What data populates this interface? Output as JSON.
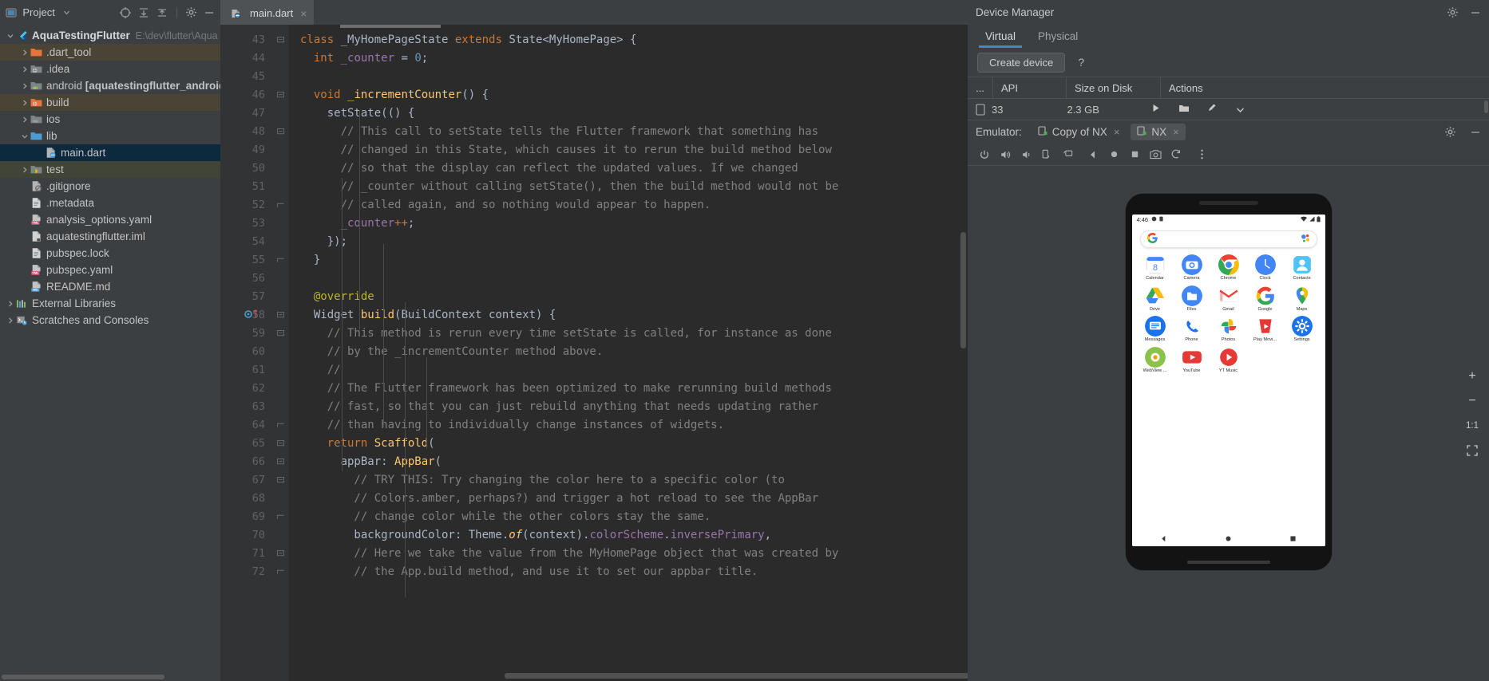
{
  "project_panel": {
    "title": "Project",
    "toolbar_icons": [
      "project-view-icon",
      "dropdown-icon",
      "locate-icon",
      "expand-all-icon",
      "collapse-all-icon",
      "settings-icon",
      "hide-icon"
    ],
    "root": {
      "name": "AquaTestingFlutter",
      "path": "E:\\dev\\flutter\\Aqua"
    },
    "items": [
      {
        "label": ".dart_tool",
        "icon": "folder-orange-icon",
        "indent": 1,
        "arrow": "right",
        "state": "highlight-1"
      },
      {
        "label": ".idea",
        "icon": "folder-idea-icon",
        "indent": 1,
        "arrow": "right",
        "state": "none"
      },
      {
        "label": "android ",
        "bold_suffix": "[aquatestingflutter_android]",
        "icon": "folder-android-icon",
        "indent": 1,
        "arrow": "right",
        "state": "none"
      },
      {
        "label": "build",
        "icon": "folder-build-icon",
        "indent": 1,
        "arrow": "right",
        "state": "highlight-1"
      },
      {
        "label": "ios",
        "icon": "folder-ios-icon",
        "indent": 1,
        "arrow": "right",
        "state": "none"
      },
      {
        "label": "lib",
        "icon": "folder-blue-icon",
        "indent": 1,
        "arrow": "down",
        "state": "none"
      },
      {
        "label": "main.dart",
        "icon": "dart-file-icon",
        "indent": 2,
        "arrow": "none",
        "state": "selected"
      },
      {
        "label": "test",
        "icon": "folder-test-icon",
        "indent": 1,
        "arrow": "right",
        "state": "highlight-2"
      },
      {
        "label": ".gitignore",
        "icon": "gitignore-file-icon",
        "indent": 1,
        "arrow": "none",
        "state": "none"
      },
      {
        "label": ".metadata",
        "icon": "text-file-icon",
        "indent": 1,
        "arrow": "none",
        "state": "none"
      },
      {
        "label": "analysis_options.yaml",
        "icon": "yaml-file-icon",
        "indent": 1,
        "arrow": "none",
        "state": "none"
      },
      {
        "label": "aquatestingflutter.iml",
        "icon": "iml-file-icon",
        "indent": 1,
        "arrow": "none",
        "state": "none"
      },
      {
        "label": "pubspec.lock",
        "icon": "text-file-icon",
        "indent": 1,
        "arrow": "none",
        "state": "none"
      },
      {
        "label": "pubspec.yaml",
        "icon": "yaml-file-icon",
        "indent": 1,
        "arrow": "none",
        "state": "none"
      },
      {
        "label": "README.md",
        "icon": "markdown-file-icon",
        "indent": 1,
        "arrow": "none",
        "state": "none"
      },
      {
        "label": "External Libraries",
        "icon": "libraries-icon",
        "indent": 0,
        "arrow": "right",
        "state": "none"
      },
      {
        "label": "Scratches and Consoles",
        "icon": "scratches-icon",
        "indent": 0,
        "arrow": "right",
        "state": "none"
      }
    ]
  },
  "editor": {
    "tab": {
      "label": "main.dart",
      "icon": "dart-file-icon",
      "close": "×"
    },
    "inspection_status": "✓",
    "first_line": 43,
    "lines": [
      {
        "n": 43,
        "fold": "start",
        "tokens": [
          {
            "t": "class ",
            "c": "kw"
          },
          {
            "t": "_MyHomePageState ",
            "c": "cls"
          },
          {
            "t": "extends ",
            "c": "kw"
          },
          {
            "t": "State<MyHomePage> {",
            "c": "cls"
          }
        ]
      },
      {
        "n": 44,
        "fold": "",
        "indent": 1,
        "tokens": [
          {
            "t": "  int",
            "c": "kw"
          },
          {
            "t": " _counter ",
            "c": "fld"
          },
          {
            "t": "= ",
            "c": "cls"
          },
          {
            "t": "0",
            "c": "num"
          },
          {
            "t": ";",
            "c": "cls"
          }
        ]
      },
      {
        "n": 45,
        "fold": "",
        "tokens": []
      },
      {
        "n": 46,
        "fold": "start",
        "tokens": [
          {
            "t": "  void ",
            "c": "kw"
          },
          {
            "t": "_incrementCounter",
            "c": "fn"
          },
          {
            "t": "() {",
            "c": "cls"
          }
        ]
      },
      {
        "n": 47,
        "fold": "",
        "tokens": [
          {
            "t": "    setState(() {",
            "c": "cls"
          }
        ]
      },
      {
        "n": 48,
        "fold": "start",
        "tokens": [
          {
            "t": "      // This call to setState tells the Flutter framework that something has",
            "c": "cm"
          }
        ]
      },
      {
        "n": 49,
        "fold": "",
        "tokens": [
          {
            "t": "      // changed in this State, which causes it to rerun the build method below",
            "c": "cm"
          }
        ]
      },
      {
        "n": 50,
        "fold": "",
        "tokens": [
          {
            "t": "      // so that the display can reflect the updated values. If we changed",
            "c": "cm"
          }
        ]
      },
      {
        "n": 51,
        "fold": "",
        "tokens": [
          {
            "t": "      // _counter without calling setState(), then the build method would not be",
            "c": "cm"
          }
        ]
      },
      {
        "n": 52,
        "fold": "end",
        "tokens": [
          {
            "t": "      // called again, and so nothing would appear to happen.",
            "c": "cm"
          }
        ]
      },
      {
        "n": 53,
        "fold": "",
        "tokens": [
          {
            "t": "      _counter",
            "c": "fld"
          },
          {
            "t": "++",
            "c": "kw"
          },
          {
            "t": ";",
            "c": "cls"
          }
        ]
      },
      {
        "n": 54,
        "fold": "",
        "tokens": [
          {
            "t": "    });",
            "c": "cls"
          }
        ]
      },
      {
        "n": 55,
        "fold": "end",
        "tokens": [
          {
            "t": "  }",
            "c": "cls"
          }
        ]
      },
      {
        "n": 56,
        "fold": "",
        "tokens": []
      },
      {
        "n": 57,
        "fold": "",
        "tokens": [
          {
            "t": "  @override",
            "c": "ann"
          }
        ]
      },
      {
        "n": 58,
        "fold": "start",
        "gutter_mark": "run-override-marker",
        "tokens": [
          {
            "t": "  Widget ",
            "c": "cls"
          },
          {
            "t": "build",
            "c": "fn"
          },
          {
            "t": "(BuildContext context) {",
            "c": "cls"
          }
        ]
      },
      {
        "n": 59,
        "fold": "start",
        "tokens": [
          {
            "t": "    // This method is rerun every time setState is called, for instance as done",
            "c": "cm"
          }
        ]
      },
      {
        "n": 60,
        "fold": "",
        "tokens": [
          {
            "t": "    // by the _incrementCounter method above.",
            "c": "cm"
          }
        ]
      },
      {
        "n": 61,
        "fold": "",
        "tokens": [
          {
            "t": "    //",
            "c": "cm"
          }
        ]
      },
      {
        "n": 62,
        "fold": "",
        "tokens": [
          {
            "t": "    // The Flutter framework has been optimized to make rerunning build methods",
            "c": "cm"
          }
        ]
      },
      {
        "n": 63,
        "fold": "",
        "tokens": [
          {
            "t": "    // fast, so that you can just rebuild anything that needs updating rather",
            "c": "cm"
          }
        ]
      },
      {
        "n": 64,
        "fold": "end",
        "tokens": [
          {
            "t": "    // than having to individually change instances of widgets.",
            "c": "cm"
          }
        ]
      },
      {
        "n": 65,
        "fold": "start",
        "tokens": [
          {
            "t": "    return ",
            "c": "kw"
          },
          {
            "t": "Scaffold",
            "c": "fn"
          },
          {
            "t": "(",
            "c": "cls"
          }
        ]
      },
      {
        "n": 66,
        "fold": "start",
        "tokens": [
          {
            "t": "      appBar: ",
            "c": "cls"
          },
          {
            "t": "AppBar",
            "c": "fn"
          },
          {
            "t": "(",
            "c": "cls"
          }
        ]
      },
      {
        "n": 67,
        "fold": "start",
        "tokens": [
          {
            "t": "        // TRY THIS: Try changing the color here to a specific color (to",
            "c": "cm"
          }
        ]
      },
      {
        "n": 68,
        "fold": "",
        "tokens": [
          {
            "t": "        // Colors.amber, perhaps?) and trigger a hot reload to see the AppBar",
            "c": "cm"
          }
        ]
      },
      {
        "n": 69,
        "fold": "end",
        "tokens": [
          {
            "t": "        // change color while the other colors stay the same.",
            "c": "cm"
          }
        ]
      },
      {
        "n": 70,
        "fold": "",
        "tokens": [
          {
            "t": "        backgroundColor: Theme.",
            "c": "cls"
          },
          {
            "t": "of",
            "c": "fn ital"
          },
          {
            "t": "(context).",
            "c": "cls"
          },
          {
            "t": "colorScheme",
            "c": "fld"
          },
          {
            "t": ".",
            "c": "cls"
          },
          {
            "t": "inversePrimary",
            "c": "fld"
          },
          {
            "t": ",",
            "c": "cls"
          }
        ]
      },
      {
        "n": 71,
        "fold": "start",
        "tokens": [
          {
            "t": "        // Here we take the value from the MyHomePage object that was created by",
            "c": "cm"
          }
        ]
      },
      {
        "n": 72,
        "fold": "end",
        "tokens": [
          {
            "t": "        // the App.build method, and use it to set our appbar title.",
            "c": "cm"
          }
        ]
      }
    ]
  },
  "device_manager": {
    "title": "Device Manager",
    "header_icons": [
      "gear-icon",
      "hide-icon"
    ],
    "tabs": [
      {
        "label": "Virtual",
        "active": true
      },
      {
        "label": "Physical",
        "active": false
      }
    ],
    "create_device_label": "Create device",
    "help_label": "?",
    "columns": [
      "...",
      "API",
      "Size on Disk",
      "Actions"
    ],
    "row_actions": [
      "play-icon",
      "folder-icon",
      "edit-icon",
      "chevron-down-icon"
    ],
    "emulator_bar": {
      "label": "Emulator:",
      "tabs": [
        {
          "label": "Copy of NX",
          "active": false,
          "close": "×",
          "icon": "device-icon"
        },
        {
          "label": "NX",
          "active": true,
          "close": "×",
          "icon": "device-icon"
        }
      ],
      "right_icons": [
        "gear-icon",
        "minimize-icon"
      ]
    },
    "emulator_toolbar_icons": [
      "power-icon",
      "volume-up-icon",
      "volume-down-icon",
      "rotate-left-icon",
      "rotate-right-icon",
      "back-icon",
      "home-icon",
      "overview-icon",
      "screenshot-icon",
      "record-icon",
      "more-icon"
    ],
    "side_controls": [
      "zoom-in-icon",
      "zoom-out-icon",
      "1:1",
      "fit-screen-icon"
    ]
  },
  "emulator_screen": {
    "status_time": "4:46",
    "status_icons_left": [
      "do-not-disturb-icon",
      "battery-saver-icon"
    ],
    "status_icons_right": [
      "wifi-icon",
      "signal-icon",
      "battery-icon"
    ],
    "search_bar": {
      "left_icon": "google-g-icon",
      "right_icon": "assistant-icon"
    },
    "apps": [
      {
        "name": "Calendar",
        "icon": "calendar-icon"
      },
      {
        "name": "Camera",
        "icon": "camera-icon"
      },
      {
        "name": "Chrome",
        "icon": "chrome-icon"
      },
      {
        "name": "Clock",
        "icon": "clock-icon"
      },
      {
        "name": "Contacts",
        "icon": "contacts-icon"
      },
      {
        "name": "Drive",
        "icon": "drive-icon"
      },
      {
        "name": "Files",
        "icon": "files-icon"
      },
      {
        "name": "Gmail",
        "icon": "gmail-icon"
      },
      {
        "name": "Google",
        "icon": "google-icon"
      },
      {
        "name": "Maps",
        "icon": "maps-icon"
      },
      {
        "name": "Messages",
        "icon": "messages-icon"
      },
      {
        "name": "Phone",
        "icon": "phone-icon"
      },
      {
        "name": "Photos",
        "icon": "photos-icon"
      },
      {
        "name": "Play Movi...",
        "icon": "play-movies-icon"
      },
      {
        "name": "Settings",
        "icon": "settings-icon"
      },
      {
        "name": "WebView ...",
        "icon": "webview-icon"
      },
      {
        "name": "YouTube",
        "icon": "youtube-icon"
      },
      {
        "name": "YT Music",
        "icon": "yt-music-icon"
      }
    ],
    "nav_buttons": [
      "back-nav-icon",
      "home-nav-icon",
      "recents-nav-icon"
    ]
  },
  "colors": {
    "ide_bg": "#3c3f41",
    "editor_bg": "#2b2b2b",
    "gutter_bg": "#313335",
    "selection": "#0d293e",
    "accent_blue": "#3e86d6",
    "keyword": "#cc7832",
    "comment": "#808080",
    "function": "#ffc66d",
    "number": "#6897bb",
    "field": "#9876aa",
    "annotation": "#bbb529",
    "ok_green": "#62b543"
  }
}
